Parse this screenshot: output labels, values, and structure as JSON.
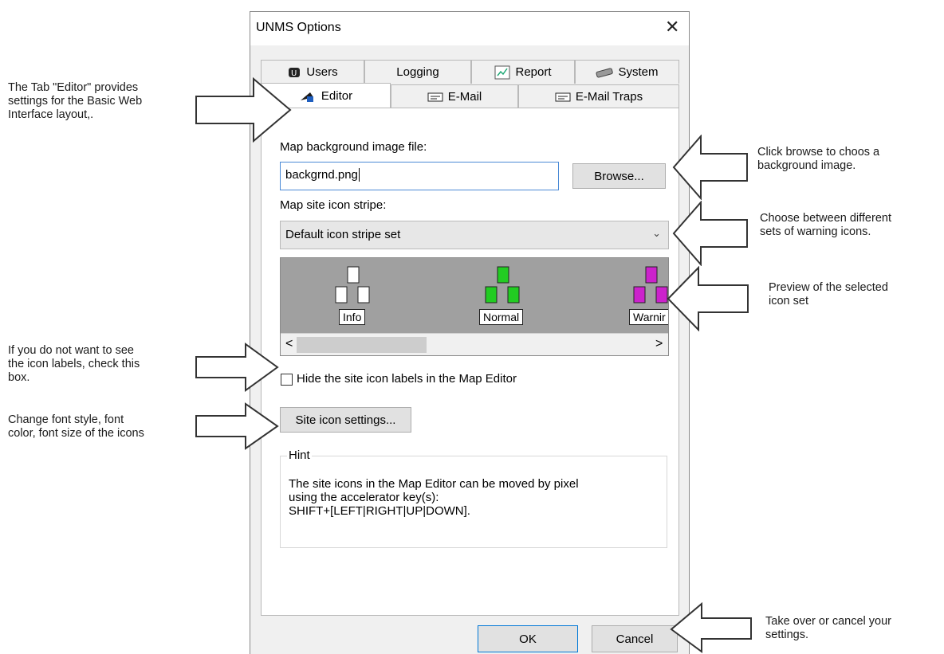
{
  "dialog": {
    "title": "UNMS Options",
    "close_glyph": "✕",
    "tabs_row1": [
      {
        "label": "Users",
        "icon": "users-icon"
      },
      {
        "label": "Logging",
        "icon": ""
      },
      {
        "label": "Report",
        "icon": "report-icon"
      },
      {
        "label": "System",
        "icon": "system-icon"
      }
    ],
    "tabs_row2": [
      {
        "label": "Editor",
        "icon": "editor-icon"
      },
      {
        "label": "E-Mail",
        "icon": "email-icon"
      },
      {
        "label": "E-Mail Traps",
        "icon": "email-traps-icon"
      }
    ],
    "active_tab": "Editor",
    "editor": {
      "bg_label": "Map background image file:",
      "bg_value": "backgrnd.png",
      "browse_label": "Browse...",
      "stripe_label": "Map site icon stripe:",
      "stripe_selected": "Default icon stripe set",
      "preview_icons": [
        {
          "label": "Info",
          "color": "#ffffff"
        },
        {
          "label": "Normal",
          "color": "#22cc22"
        },
        {
          "label": "Warnir",
          "color": "#cc22cc"
        }
      ],
      "scroll_left": "<",
      "scroll_right": ">",
      "hide_labels_text": "Hide the site icon labels in the Map Editor",
      "hide_labels_checked": false,
      "site_icon_settings_label": "Site icon settings...",
      "hint_title": "Hint",
      "hint_text": "The site icons in the Map Editor can be moved by pixel\nusing the accelerator key(s):\nSHIFT+[LEFT|RIGHT|UP|DOWN]."
    },
    "ok_label": "OK",
    "cancel_label": "Cancel"
  },
  "annotations": {
    "editor_tab": "The Tab \"Editor\" provides\nsettings for the Basic Web\nInterface layout,.",
    "browse": "Click browse to choos a\nbackground image.",
    "stripe": "Choose between different\nsets of warning icons.",
    "preview": "Preview of the selected\nicon set",
    "hide_labels": "If you do not want to see\nthe icon labels, check this\nbox.",
    "site_icon_settings": "Change font style, font\ncolor, font size of the icons",
    "ok_cancel": "Take over or cancel your\nsettings."
  }
}
